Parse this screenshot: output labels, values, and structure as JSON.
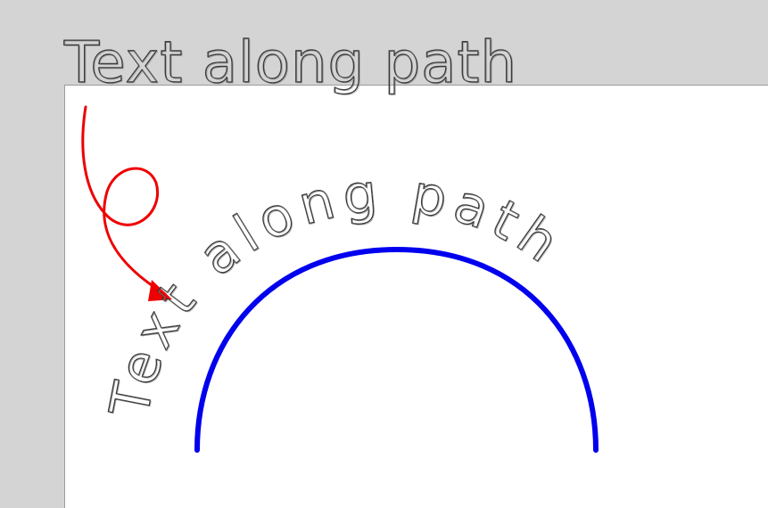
{
  "heading": {
    "text": "Text along path"
  },
  "path_text": {
    "text": "Text along path"
  },
  "colors": {
    "background": "#d4d4d4",
    "page": "#ffffff",
    "arc": "#0000ee",
    "arrow": "#ee0000",
    "letter_outline": "#3a3a3a"
  },
  "icons": {
    "arrow": "curly-red-arrow"
  }
}
